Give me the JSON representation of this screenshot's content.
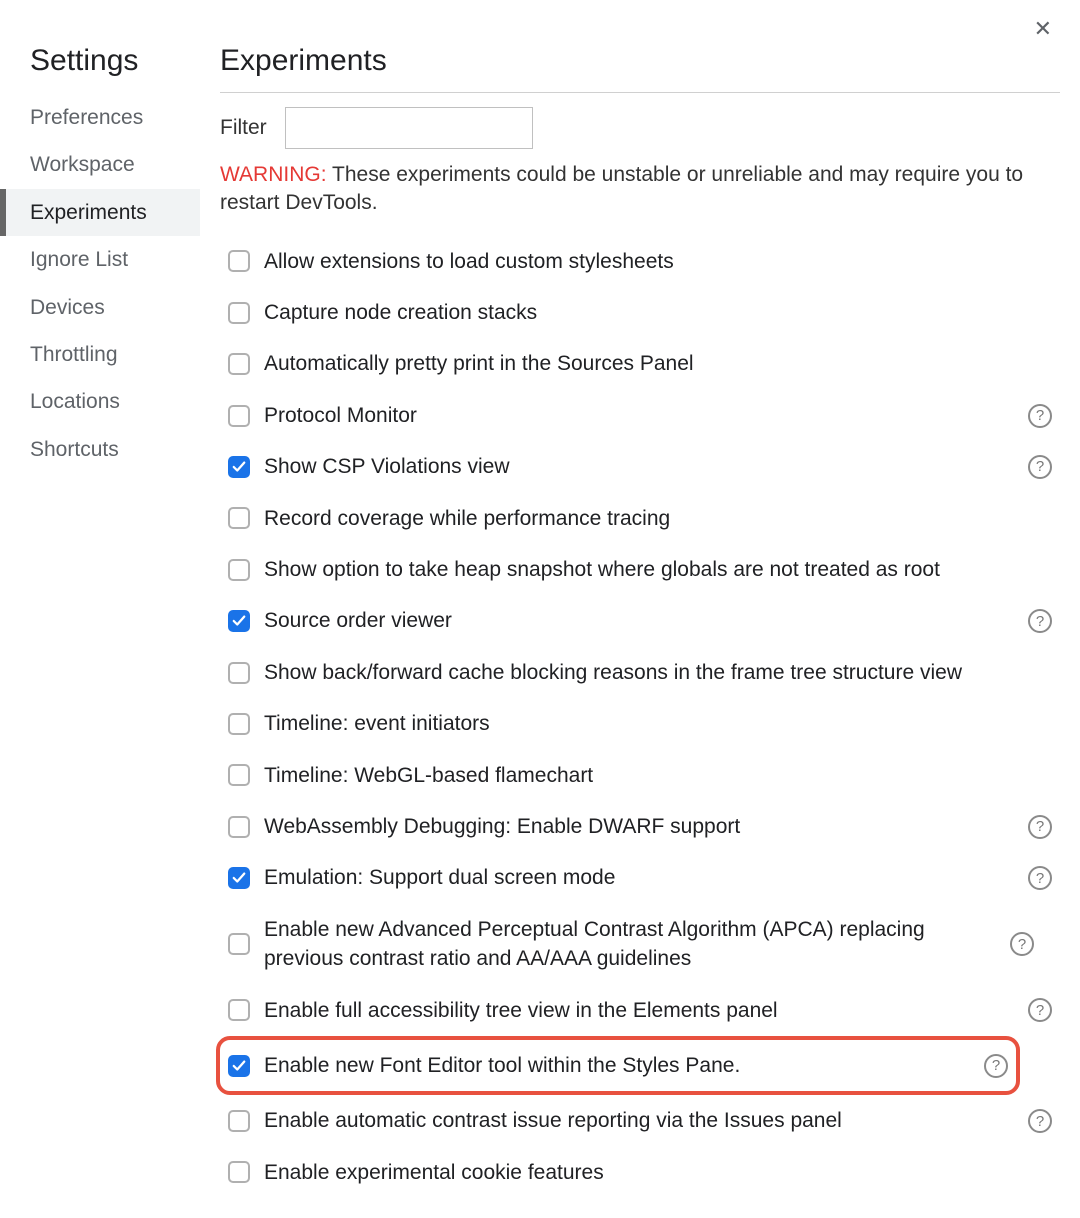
{
  "close_glyph": "✕",
  "sidebar": {
    "title": "Settings",
    "items": [
      {
        "label": "Preferences",
        "selected": false
      },
      {
        "label": "Workspace",
        "selected": false
      },
      {
        "label": "Experiments",
        "selected": true
      },
      {
        "label": "Ignore List",
        "selected": false
      },
      {
        "label": "Devices",
        "selected": false
      },
      {
        "label": "Throttling",
        "selected": false
      },
      {
        "label": "Locations",
        "selected": false
      },
      {
        "label": "Shortcuts",
        "selected": false
      }
    ]
  },
  "main": {
    "title": "Experiments",
    "filter_label": "Filter",
    "filter_value": "",
    "warning_prefix": "WARNING:",
    "warning_text": " These experiments could be unstable or unreliable and may require you to restart DevTools.",
    "help_glyph": "?",
    "experiments": [
      {
        "label": "Allow extensions to load custom stylesheets",
        "checked": false,
        "help": false,
        "highlighted": false
      },
      {
        "label": "Capture node creation stacks",
        "checked": false,
        "help": false,
        "highlighted": false
      },
      {
        "label": "Automatically pretty print in the Sources Panel",
        "checked": false,
        "help": false,
        "highlighted": false
      },
      {
        "label": "Protocol Monitor",
        "checked": false,
        "help": true,
        "highlighted": false
      },
      {
        "label": "Show CSP Violations view",
        "checked": true,
        "help": true,
        "highlighted": false
      },
      {
        "label": "Record coverage while performance tracing",
        "checked": false,
        "help": false,
        "highlighted": false
      },
      {
        "label": "Show option to take heap snapshot where globals are not treated as root",
        "checked": false,
        "help": false,
        "highlighted": false
      },
      {
        "label": "Source order viewer",
        "checked": true,
        "help": true,
        "highlighted": false
      },
      {
        "label": "Show back/forward cache blocking reasons in the frame tree structure view",
        "checked": false,
        "help": false,
        "highlighted": false
      },
      {
        "label": "Timeline: event initiators",
        "checked": false,
        "help": false,
        "highlighted": false
      },
      {
        "label": "Timeline: WebGL-based flamechart",
        "checked": false,
        "help": false,
        "highlighted": false
      },
      {
        "label": "WebAssembly Debugging: Enable DWARF support",
        "checked": false,
        "help": true,
        "highlighted": false
      },
      {
        "label": "Emulation: Support dual screen mode",
        "checked": true,
        "help": true,
        "highlighted": false
      },
      {
        "label": "Enable new Advanced Perceptual Contrast Algorithm (APCA) replacing previous contrast ratio and AA/AAA guidelines",
        "checked": false,
        "help": true,
        "help_right": true,
        "highlighted": false
      },
      {
        "label": "Enable full accessibility tree view in the Elements panel",
        "checked": false,
        "help": true,
        "highlighted": false
      },
      {
        "label": "Enable new Font Editor tool within the Styles Pane.",
        "checked": true,
        "help": true,
        "highlighted": true
      },
      {
        "label": "Enable automatic contrast issue reporting via the Issues panel",
        "checked": false,
        "help": true,
        "highlighted": false
      },
      {
        "label": "Enable experimental cookie features",
        "checked": false,
        "help": false,
        "highlighted": false
      }
    ]
  }
}
